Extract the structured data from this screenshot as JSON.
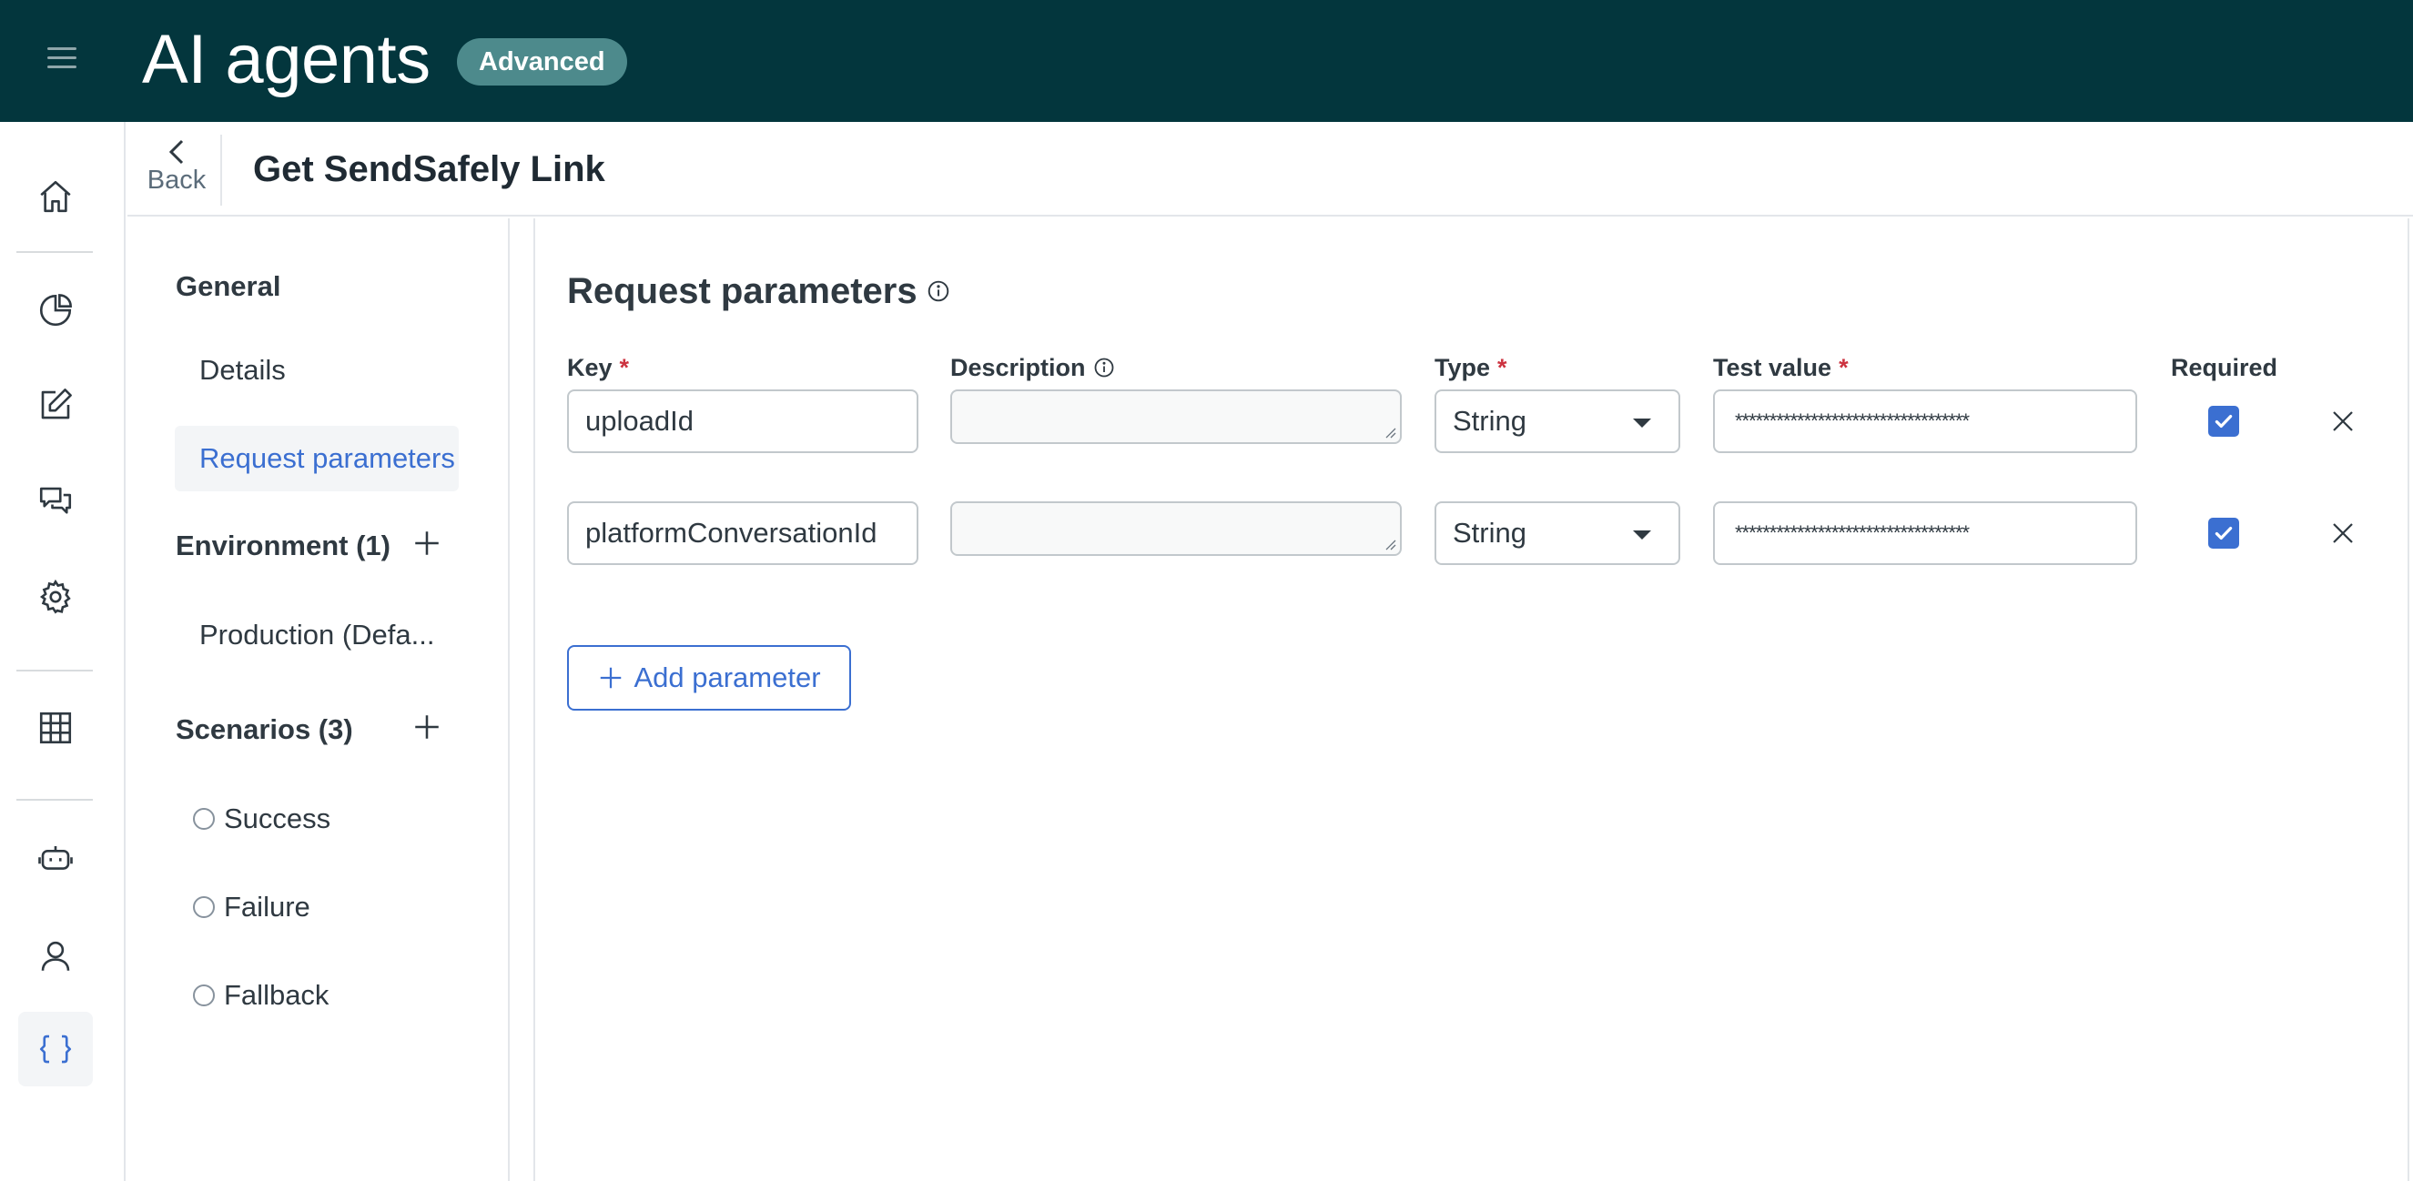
{
  "header": {
    "app_title": "AI agents",
    "badge": "Advanced"
  },
  "rail": {
    "items": [
      {
        "icon": "home-icon"
      },
      {
        "icon": "pie-chart-icon"
      },
      {
        "icon": "edit-icon"
      },
      {
        "icon": "conversations-icon"
      },
      {
        "icon": "gear-icon"
      },
      {
        "icon": "table-icon"
      },
      {
        "icon": "bot-icon"
      },
      {
        "icon": "person-icon"
      },
      {
        "icon": "code-braces-icon",
        "active": true
      }
    ]
  },
  "page": {
    "back_label": "Back",
    "title": "Get SendSafely Link"
  },
  "subnav": {
    "general": {
      "heading": "General",
      "items": [
        "Details",
        "Request parameters"
      ],
      "selected": "Request parameters"
    },
    "environment": {
      "heading": "Environment (1)",
      "items": [
        "Production (Defa..."
      ]
    },
    "scenarios": {
      "heading": "Scenarios (3)",
      "items": [
        "Success",
        "Failure",
        "Fallback"
      ]
    }
  },
  "main": {
    "section_title": "Request parameters",
    "columns": {
      "key": "Key",
      "description": "Description",
      "type": "Type",
      "test_value": "Test value",
      "required": "Required",
      "required_marker": "*"
    },
    "rows": [
      {
        "key": "uploadId",
        "description": "",
        "type": "String",
        "test_value": "**********************************",
        "required": true
      },
      {
        "key": "platformConversationId",
        "description": "",
        "type": "String",
        "test_value": "**********************************",
        "required": true
      }
    ],
    "add_button": "Add parameter"
  },
  "colors": {
    "header_bg": "#03363d",
    "badge_bg": "#4d8a8c",
    "accent_blue": "#3b6fd1",
    "required_red": "#cc3340"
  }
}
